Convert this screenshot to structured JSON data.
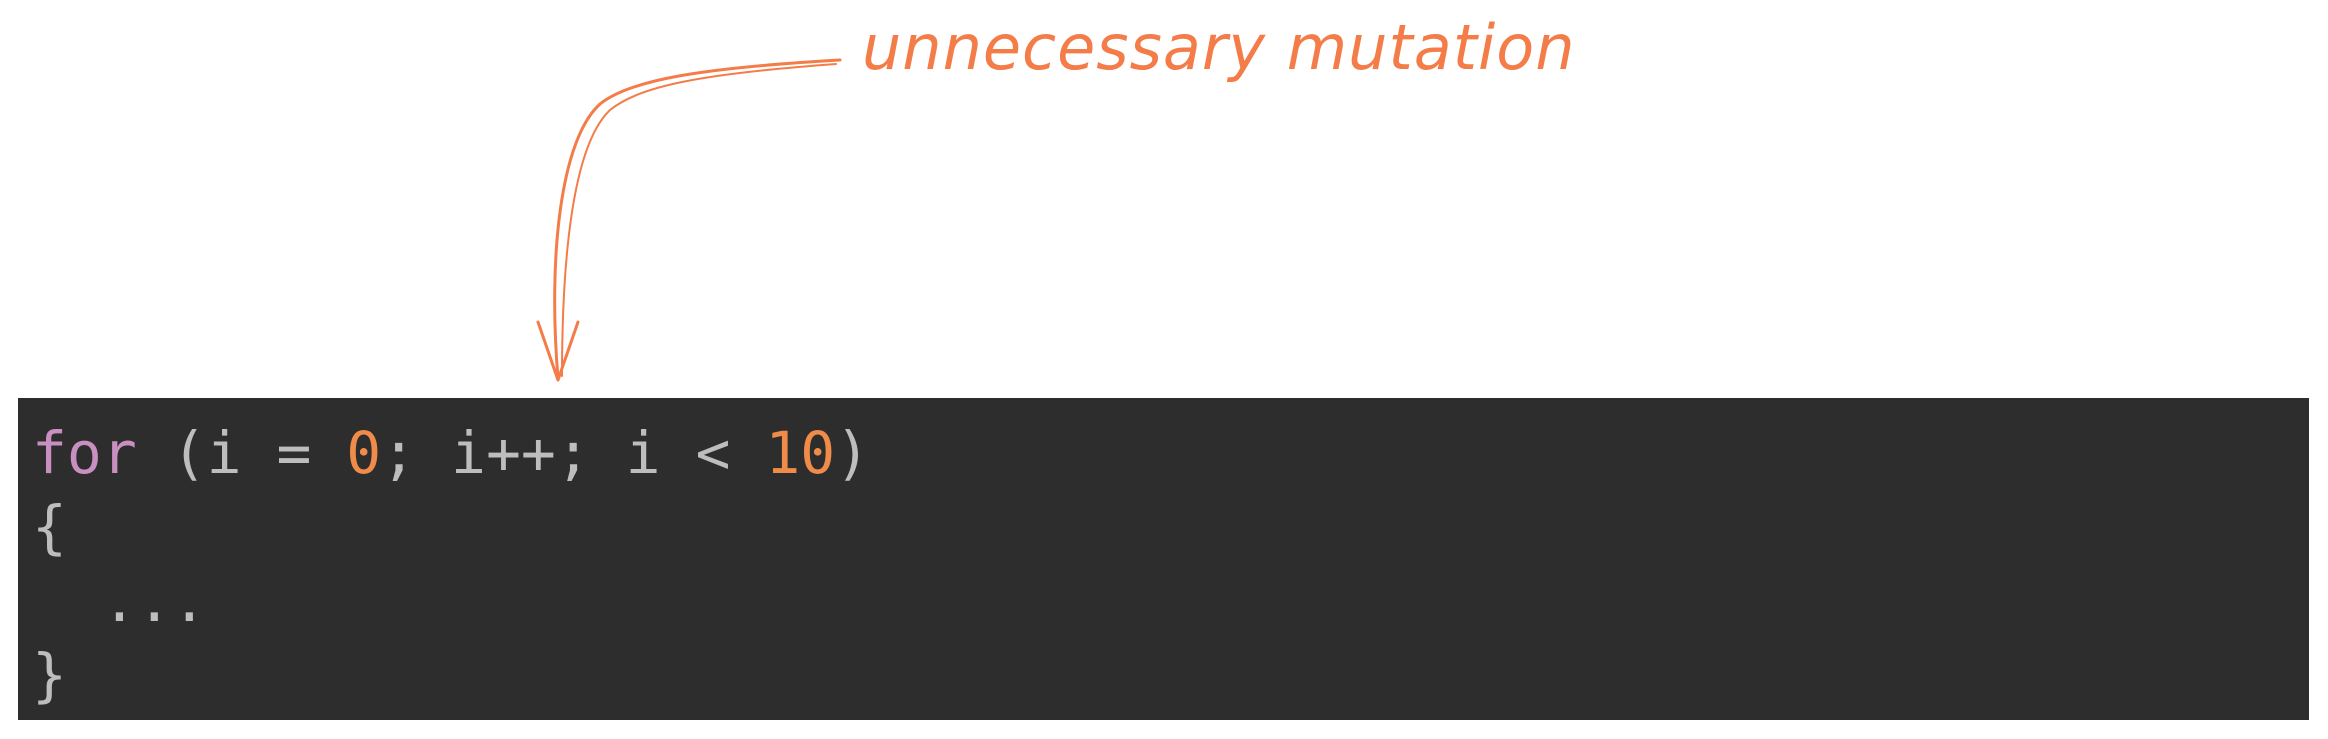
{
  "annotation": {
    "text": "unnecessary mutation",
    "color": "#f47c48"
  },
  "code": {
    "background": "#2d2d2d",
    "colors": {
      "keyword": "#c98fc0",
      "punct": "#bdbdbd",
      "number": "#f08c4a"
    },
    "line1": {
      "keyword": "for",
      "open": " (i = ",
      "num1": "0",
      "mid": "; i++; i < ",
      "num2": "10",
      "close": ")"
    },
    "line2": "{",
    "line3": "...",
    "line4": "}"
  }
}
